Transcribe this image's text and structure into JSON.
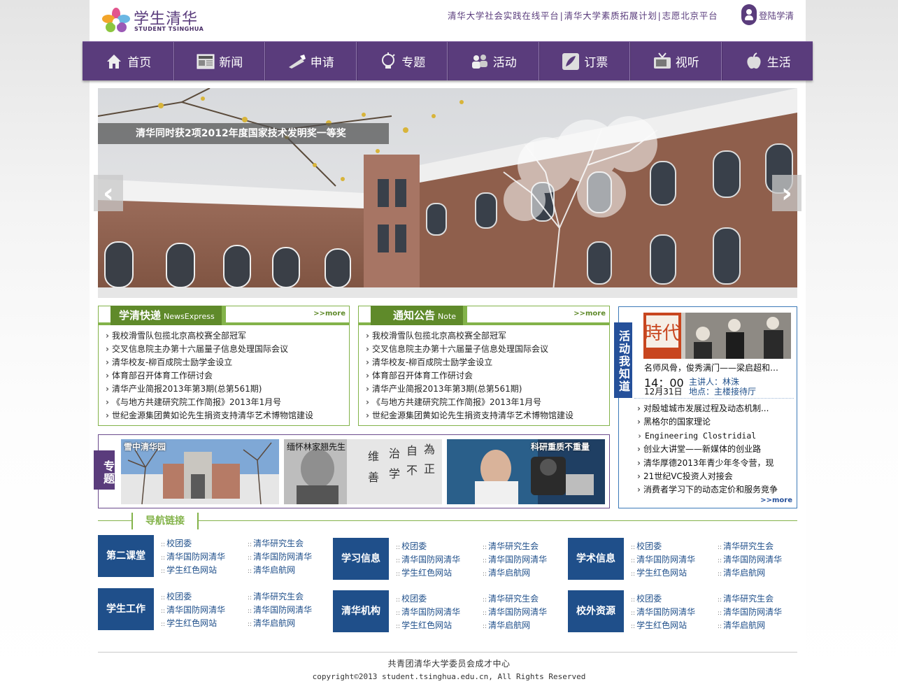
{
  "header": {
    "logo_cn": "学生清华",
    "logo_en": "STUDENT TSINGHUA",
    "top_links": [
      "清华大学社会实践在线平台",
      "清华大学素质拓展计划",
      "志愿北京平台"
    ],
    "login": "登陆学清"
  },
  "nav": [
    {
      "label": "首页",
      "icon": "home-icon"
    },
    {
      "label": "新闻",
      "icon": "newspaper-icon"
    },
    {
      "label": "申请",
      "icon": "pen-icon"
    },
    {
      "label": "专题",
      "icon": "lightbulb-icon"
    },
    {
      "label": "活动",
      "icon": "people-icon"
    },
    {
      "label": "订票",
      "icon": "ticket-icon"
    },
    {
      "label": "视听",
      "icon": "tv-icon"
    },
    {
      "label": "生活",
      "icon": "apple-icon"
    }
  ],
  "banner": {
    "caption": "清华同时获2项2012年度国家技术发明奖一等奖"
  },
  "news_express": {
    "title": "学清快递",
    "title_en": "NewsExpress",
    "more": ">>more",
    "items": [
      "我校滑雪队包揽北京高校赛全部冠军",
      "交叉信息院主办第十六届量子信息处理国际会议",
      "清华校友-柳百成院士励学金设立",
      "体育部召开体育工作研讨会",
      "清华产业简报2013年第3期(总第561期)",
      "《与地方共建研究院工作简报》2013年1月号",
      "世纪金源集团黄如论先生捐资支持清华艺术博物馆建设"
    ]
  },
  "notice": {
    "title": "通知公告",
    "title_en": "Note",
    "more": ">>more",
    "items": [
      "我校滑雪队包揽北京高校赛全部冠军",
      "交叉信息院主办第十六届量子信息处理国际会议",
      "清华校友-柳百成院士励学金设立",
      "体育部召开体育工作研讨会",
      "清华产业简报2013年第3期(总第561期)",
      "《与地方共建研究院工作简报》2013年1月号",
      "世纪金源集团黄如论先生捐资支持清华艺术博物馆建设"
    ]
  },
  "events": {
    "tab": "活动我知道",
    "image_text": "時代",
    "featured_title": "名师风骨，俊秀满门——梁启超和…",
    "time": "14：00",
    "speaker": "主讲人：林洙",
    "date": "12月31日",
    "place": "地点：主楼接待厅",
    "items": [
      "对殷墟城市发展过程及动态机制...",
      "黑格尔的国家理论",
      "Engineering Clostridial",
      "创业大讲堂——新媒体的创业路",
      "清华厚德2013年青少年冬令营，现",
      "21世纪VC投资人对接会",
      "消费者学习下的动态定价和服务竞争"
    ],
    "more": ">>more"
  },
  "topics": {
    "tab": "专题",
    "items": [
      "雪中清华园",
      "缅怀林家翘先生",
      "科研重质不重量"
    ]
  },
  "nav_links": {
    "title": "导航链接",
    "groups": [
      {
        "category": "第二课堂",
        "links": [
          "校团委",
          "清华研究生会",
          "清华国防网清华",
          "清华国防网清华",
          "学生红色网站",
          "清华启航网"
        ]
      },
      {
        "category": "学习信息",
        "links": [
          "校团委",
          "清华研究生会",
          "清华国防网清华",
          "清华国防网清华",
          "学生红色网站",
          "清华启航网"
        ]
      },
      {
        "category": "学术信息",
        "links": [
          "校团委",
          "清华研究生会",
          "清华国防网清华",
          "清华国防网清华",
          "学生红色网站",
          "清华启航网"
        ]
      },
      {
        "category": "学生工作",
        "links": [
          "校团委",
          "清华研究生会",
          "清华国防网清华",
          "清华国防网清华",
          "学生红色网站",
          "清华启航网"
        ]
      },
      {
        "category": "清华机构",
        "links": [
          "校团委",
          "清华研究生会",
          "清华国防网清华",
          "清华国防网清华",
          "学生红色网站",
          "清华启航网"
        ]
      },
      {
        "category": "校外资源",
        "links": [
          "校团委",
          "清华研究生会",
          "清华国防网清华",
          "清华国防网清华",
          "学生红色网站",
          "清华启航网"
        ]
      }
    ]
  },
  "footer": {
    "line1": "共青团清华大学委员会成才中心",
    "line2": "copyright©2013 student.tsinghua.edu.cn, All Rights Reserved"
  },
  "colors": {
    "purple": "#5a3c7c",
    "green": "#83b34a",
    "blue": "#1f4f8a"
  }
}
